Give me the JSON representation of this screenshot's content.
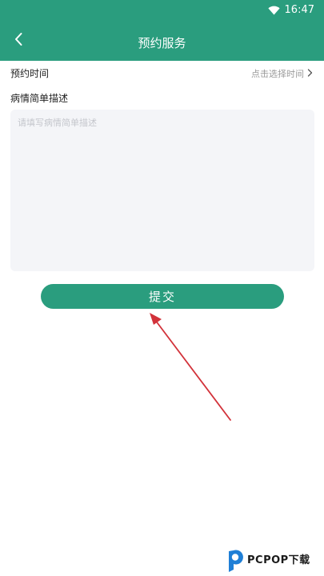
{
  "status_bar": {
    "time": "16:47",
    "icon": "wifi-icon"
  },
  "header": {
    "title": "预约服务",
    "back_icon": "chevron-left-icon"
  },
  "form": {
    "time_row": {
      "label": "预约时间",
      "value": "点击选择时间",
      "icon": "chevron-right-icon"
    },
    "description": {
      "label": "病情简单描述",
      "placeholder": "请填写病情简单描述",
      "value": ""
    },
    "submit_label": "提交"
  },
  "watermark": {
    "brand": "PCPOP下载"
  },
  "colors": {
    "primary": "#2a9d7e",
    "input_bg": "#f4f5f8",
    "annotation_arrow": "#d2323a",
    "watermark_blue": "#1f7fd6"
  }
}
